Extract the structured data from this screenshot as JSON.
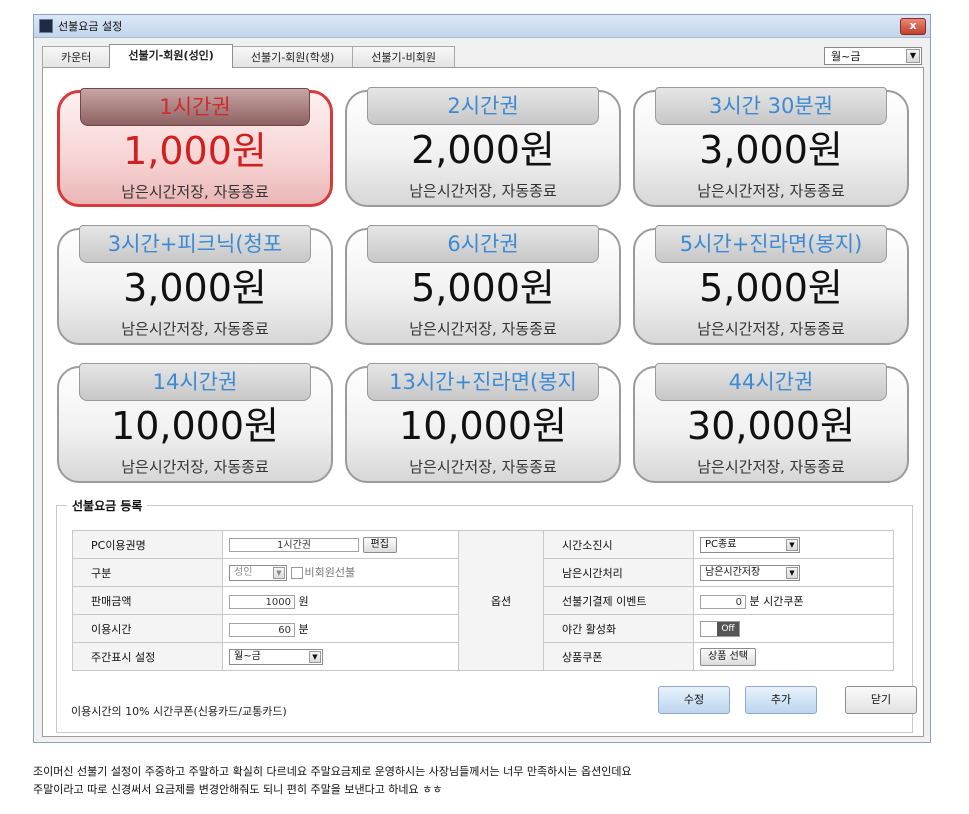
{
  "window": {
    "title": "선불요금 설정",
    "close_label": "x"
  },
  "tabs": [
    {
      "label": "카운터",
      "active": false
    },
    {
      "label": "선불기-회원(성인)",
      "active": true
    },
    {
      "label": "선불기-회원(학생)",
      "active": false
    },
    {
      "label": "선불기-비회원",
      "active": false
    }
  ],
  "day_select": {
    "value": "월~금"
  },
  "cards": [
    {
      "title": "1시간권",
      "price": "1,000원",
      "desc": "남은시간저장, 자동종료",
      "selected": true
    },
    {
      "title": "2시간권",
      "price": "2,000원",
      "desc": "남은시간저장, 자동종료",
      "selected": false
    },
    {
      "title": "3시간 30분권",
      "price": "3,000원",
      "desc": "남은시간저장, 자동종료",
      "selected": false
    },
    {
      "title": "3시간+피크닉(청포",
      "price": "3,000원",
      "desc": "남은시간저장, 자동종료",
      "selected": false
    },
    {
      "title": "6시간권",
      "price": "5,000원",
      "desc": "남은시간저장, 자동종료",
      "selected": false
    },
    {
      "title": "5시간+진라면(봉지)",
      "price": "5,000원",
      "desc": "남은시간저장, 자동종료",
      "selected": false
    },
    {
      "title": "14시간권",
      "price": "10,000원",
      "desc": "남은시간저장, 자동종료",
      "selected": false
    },
    {
      "title": "13시간+진라면(봉지",
      "price": "10,000원",
      "desc": "남은시간저장, 자동종료",
      "selected": false
    },
    {
      "title": "44시간권",
      "price": "30,000원",
      "desc": "남은시간저장, 자동종료",
      "selected": false
    }
  ],
  "registration": {
    "legend": "선불요금 등록",
    "option_label": "옵션",
    "pc_name": {
      "label": "PC이용권명",
      "value": "1시간권",
      "edit_btn": "편집"
    },
    "category": {
      "label": "구분",
      "value": "성인",
      "nonmember_label": "비회원선불"
    },
    "price": {
      "label": "판매금액",
      "value": "1000",
      "unit": "원"
    },
    "use_time": {
      "label": "이용시간",
      "value": "60",
      "unit": "분"
    },
    "weekday": {
      "label": "주간표시 설정",
      "value": "월~금"
    },
    "time_exhaust": {
      "label": "시간소진시",
      "value": "PC종료"
    },
    "remaining": {
      "label": "남은시간처리",
      "value": "남은시간저장"
    },
    "event": {
      "label": "선불기결제 이벤트",
      "value": "0",
      "unit": "분 시간쿠폰"
    },
    "night": {
      "label": "야간 활성화",
      "toggle": "Off"
    },
    "coupon": {
      "label": "상품쿠폰",
      "btn": "상품 선택"
    },
    "note": "이용시간의 10% 시간쿠폰(신용카드/교통카드)",
    "buttons": {
      "edit": "수정",
      "add": "추가",
      "close": "닫기"
    }
  },
  "caption": {
    "line1": "조이머신 선불기 설정이 주중하고 주말하고 확실히 다르네요 주말요금제로 운영하시는 사장님들께서는 너무 만족하시는 옵션인데요",
    "line2": "주말이라고 따로 신경써서 요금제를 변경안해줘도 되니 편히 주말을 보낸다고 하네요 ㅎㅎ"
  }
}
